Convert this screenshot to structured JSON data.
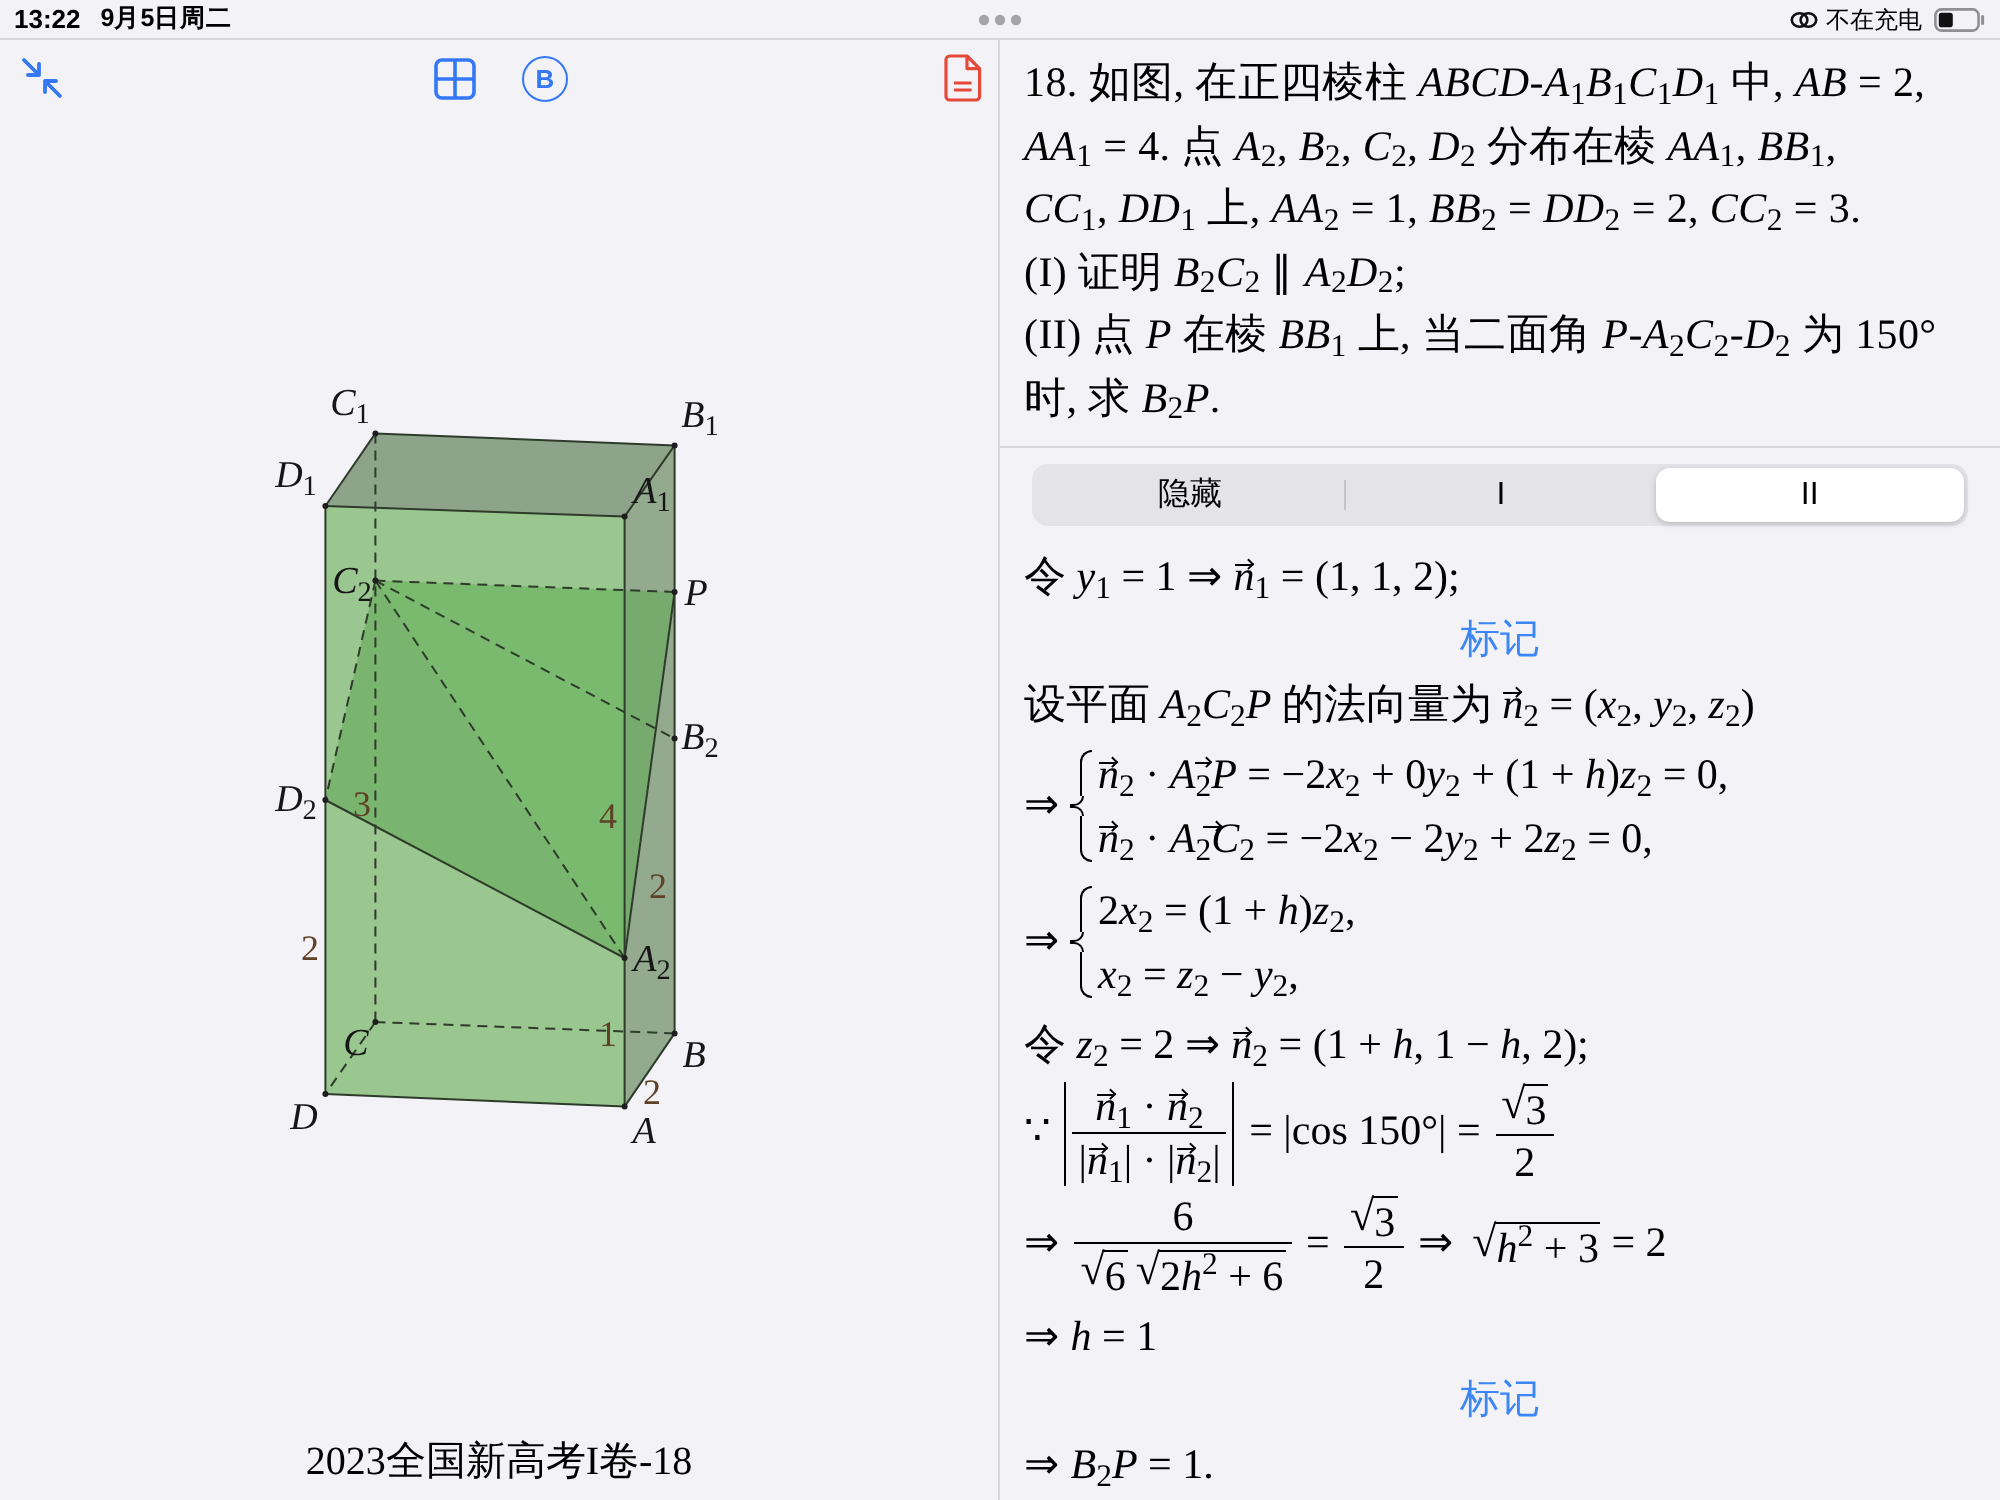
{
  "status_bar": {
    "time": "13:22",
    "date": "9月5日周二",
    "charging": "不在充电"
  },
  "toolbar": {
    "circle_button": "B"
  },
  "figure": {
    "labels": [
      {
        "kind": "vertex",
        "text": "*C*$_{1}$"
      },
      {
        "kind": "vertex",
        "text": "*B*$_{1}$"
      },
      {
        "kind": "vertex",
        "text": "*D*$_{1}$"
      },
      {
        "kind": "vertex",
        "text": "*A*$_{1}$"
      },
      {
        "kind": "vertex",
        "text": "*C*$_{2}$"
      },
      {
        "kind": "vertex",
        "text": "*P*"
      },
      {
        "kind": "vertex",
        "text": "*B*$_{2}$"
      },
      {
        "kind": "vertex",
        "text": "*D*$_{2}$"
      },
      {
        "kind": "length",
        "text": "3"
      },
      {
        "kind": "length",
        "text": "4"
      },
      {
        "kind": "length",
        "text": "2"
      },
      {
        "kind": "length",
        "text": "2"
      },
      {
        "kind": "vertex",
        "text": "*A*$_{2}$"
      },
      {
        "kind": "length",
        "text": "1"
      },
      {
        "kind": "vertex",
        "text": "*C*"
      },
      {
        "kind": "vertex",
        "text": "*B*"
      },
      {
        "kind": "length",
        "text": "2"
      },
      {
        "kind": "vertex",
        "text": "*D*"
      },
      {
        "kind": "vertex",
        "text": "*A*"
      }
    ],
    "caption": "2023全国新高考I卷-18"
  },
  "problem": {
    "paragraphs": [
      "18. 如图, 在正四棱柱 *ABCD*-*A*$_{1}$*B*$_{1}$*C*$_{1}$*D*$_{1}$ 中, *AB* = 2, *AA*$_{1}$ = 4.  点 *A*$_{2}$, *B*$_{2}$, *C*$_{2}$, *D*$_{2}$ 分布在棱 *AA*$_{1}$, *BB*$_{1}$, *CC*$_{1}$, *DD*$_{1}$ 上, *AA*$_{2}$ = 1, *BB*$_{2}$ = *DD*$_{2}$ = 2, *CC*$_{2}$ = 3.",
      "(I) 证明 *B*$_{2}$*C*$_{2}$ ∥ *A*$_{2}$*D*$_{2}$;",
      "(II) 点 *P* 在棱 *BB*$_{1}$ 上, 当二面角 *P*-*A*$_{2}$*C*$_{2}$-*D*$_{2}$ 为 150° 时, 求 *B*$_{2}$*P*."
    ]
  },
  "segments": [
    {
      "label": "隐藏",
      "selected": false
    },
    {
      "label": "I",
      "selected": false
    },
    {
      "label": "II",
      "selected": true
    }
  ],
  "solution": [
    {
      "kind": "line",
      "parts": [
        {
          "kind": "text",
          "text": "令 *y*$_{1}$ = 1 ⇒ "
        },
        {
          "kind": "vec",
          "text": "*n*"
        },
        {
          "kind": "text",
          "text": "$_{1}$ = (1, 1, 2);"
        }
      ]
    },
    {
      "kind": "link",
      "text": "标记"
    },
    {
      "kind": "line",
      "parts": [
        {
          "kind": "text",
          "text": "设平面 *A*$_{2}$*C*$_{2}$*P* 的法向量为 "
        },
        {
          "kind": "vec",
          "text": "*n*"
        },
        {
          "kind": "text",
          "text": "$_{2}$ = (*x*$_{2}$, *y*$_{2}$, *z*$_{2}$)"
        }
      ]
    },
    {
      "kind": "system",
      "lead": "⇒",
      "rows": [
        [
          {
            "kind": "vec",
            "text": "*n*"
          },
          {
            "kind": "text",
            "text": "$_{2}$ · "
          },
          {
            "kind": "vec",
            "text": "*A*$_{2}$*P*"
          },
          {
            "kind": "text",
            "text": " = −2"
          },
          {
            "kind": "text",
            "text": "*x*$_{2}$ + 0"
          },
          {
            "kind": "text",
            "text": "*y*$_{2}$ + (1 + *h*)*z*$_{2}$ = 0,"
          }
        ],
        [
          {
            "kind": "vec",
            "text": "*n*"
          },
          {
            "kind": "text",
            "text": "$_{2}$ · "
          },
          {
            "kind": "vec",
            "text": "*A*$_{2}$*C*$_{2}$"
          },
          {
            "kind": "text",
            "text": " = −2"
          },
          {
            "kind": "text",
            "text": "*x*$_{2}$ − 2"
          },
          {
            "kind": "text",
            "text": "*y*$_{2}$ + 2"
          },
          {
            "kind": "text",
            "text": "*z*$_{2}$ = 0,"
          }
        ]
      ]
    },
    {
      "kind": "system",
      "lead": "⇒",
      "rows": [
        [
          {
            "kind": "text",
            "text": "2"
          },
          {
            "kind": "text",
            "text": "*x*$_{2}$ = (1 + *h*)*z*$_{2}$,"
          }
        ],
        [
          {
            "kind": "text",
            "text": "*x*$_{2}$ = *z*$_{2}$ − *y*$_{2}$,"
          }
        ]
      ]
    },
    {
      "kind": "line",
      "parts": [
        {
          "kind": "text",
          "text": "令 *z*$_{2}$ = 2 ⇒ "
        },
        {
          "kind": "vec",
          "text": "*n*"
        },
        {
          "kind": "text",
          "text": "$_{2}$ = (1 + *h*, 1 − *h*, 2);"
        }
      ]
    },
    {
      "kind": "math",
      "parts": [
        {
          "kind": "text",
          "text": "∵ "
        },
        {
          "kind": "abs",
          "parts": [
            {
              "kind": "frac",
              "num": [
                {
                  "kind": "vec",
                  "text": "*n*"
                },
                {
                  "kind": "text",
                  "text": "$_{1}$ · "
                },
                {
                  "kind": "vec",
                  "text": "*n*"
                },
                {
                  "kind": "text",
                  "text": "$_{2}$"
                }
              ],
              "den": [
                {
                  "kind": "text",
                  "text": "|"
                },
                {
                  "kind": "vec",
                  "text": "*n*"
                },
                {
                  "kind": "text",
                  "text": "$_{1}$| · |"
                },
                {
                  "kind": "vec",
                  "text": "*n*"
                },
                {
                  "kind": "text",
                  "text": "$_{2}$|"
                }
              ]
            }
          ]
        },
        {
          "kind": "text",
          "text": " = |cos 150°| = "
        },
        {
          "kind": "frac",
          "num": [
            {
              "kind": "root",
              "sign": "√",
              "parts": [
                {
                  "kind": "text",
                  "text": "3"
                }
              ]
            }
          ],
          "den": [
            {
              "kind": "text",
              "text": "2"
            }
          ]
        }
      ]
    },
    {
      "kind": "math",
      "parts": [
        {
          "kind": "text",
          "text": "⇒ "
        },
        {
          "kind": "frac",
          "num": [
            {
              "kind": "text",
              "text": "6"
            }
          ],
          "den": [
            {
              "kind": "root",
              "sign": "√",
              "parts": [
                {
                  "kind": "text",
                  "text": "6"
                }
              ]
            },
            {
              "kind": "root",
              "sign": "√",
              "parts": [
                {
                  "kind": "text",
                  "text": "2"
                },
                {
                  "kind": "text",
                  "text": "*h*$^{2}$ + 6"
                }
              ]
            }
          ]
        },
        {
          "kind": "text",
          "text": " = "
        },
        {
          "kind": "frac",
          "num": [
            {
              "kind": "root",
              "sign": "√",
              "parts": [
                {
                  "kind": "text",
                  "text": "3"
                }
              ]
            }
          ],
          "den": [
            {
              "kind": "text",
              "text": "2"
            }
          ]
        },
        {
          "kind": "text",
          "text": " ⇒ "
        },
        {
          "kind": "root",
          "sign": "√",
          "parts": [
            {
              "kind": "text",
              "text": "*h*$^{2}$ + 3"
            }
          ]
        },
        {
          "kind": "text",
          "text": " = 2"
        }
      ]
    },
    {
      "kind": "line",
      "parts": [
        {
          "kind": "text",
          "text": "⇒ *h* = 1"
        }
      ]
    },
    {
      "kind": "link",
      "text": "标记"
    },
    {
      "kind": "line",
      "parts": [
        {
          "kind": "text",
          "text": "⇒ *B*$_{2}$*P* = 1."
        }
      ]
    }
  ]
}
